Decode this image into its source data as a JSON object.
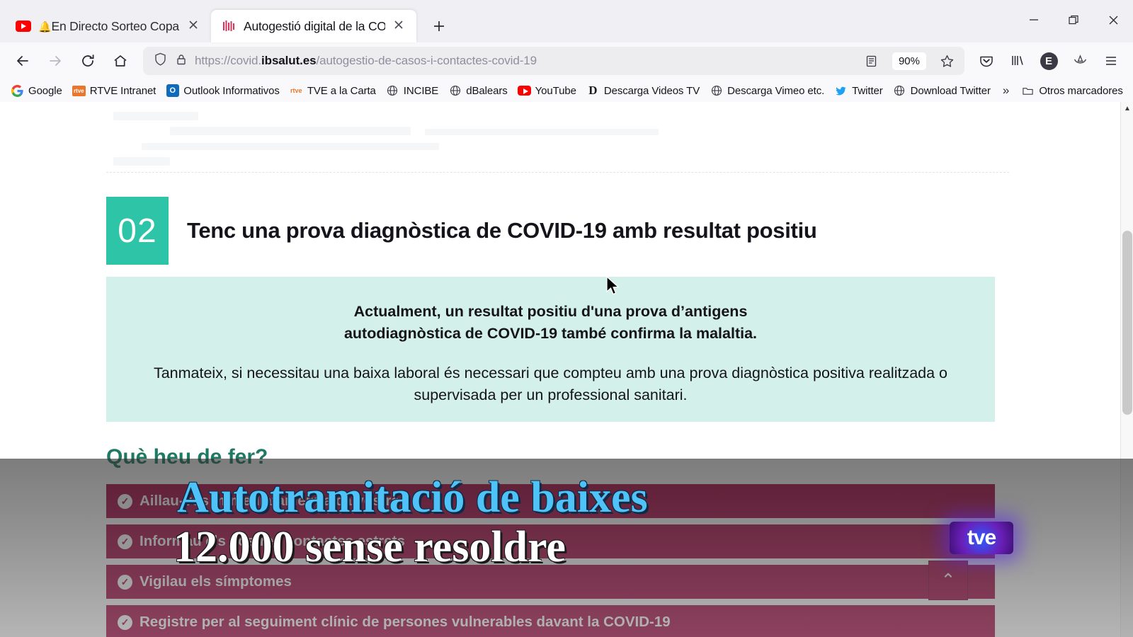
{
  "window": {
    "minimize_label": "Minimitza",
    "restore_label": "Restaura",
    "close_label": "Tanca"
  },
  "tabs": [
    {
      "title": "En Directo  Sorteo Copa de",
      "favicon": "youtube-icon",
      "active": false,
      "close_label": "×"
    },
    {
      "title": "Autogestió digital de la COVID-",
      "favicon": "ibsalut-icon",
      "active": true,
      "close_label": "×"
    }
  ],
  "newtab_label": "+",
  "toolbar": {
    "back_label": "←",
    "forward_label": "→",
    "reload_label": "↻",
    "home_label": "⌂",
    "shield_icon": "shield-icon",
    "lock_icon": "padlock-icon",
    "url_scheme": "https://covid.",
    "url_domain": "ibsalut.es",
    "url_path": "/autogestio-de-casos-i-contactes-covid-19",
    "url_full": "https://covid.ibsalut.es/autogestio-de-casos-i-contactes-covid-19",
    "reader_icon": "reader-view-icon",
    "zoom_level": "90%",
    "bookmark_star": "☆",
    "pocket_icon": "pocket-icon",
    "library_icon": "library-icon",
    "account_initial": "E",
    "container_icon": "container-tabs-icon",
    "menu_icon": "≡"
  },
  "bookmarks": {
    "items": [
      {
        "label": "Google",
        "icon": "google-icon"
      },
      {
        "label": "RTVE Intranet",
        "icon": "rtve-icon"
      },
      {
        "label": "Outlook Informativos",
        "icon": "outlook-icon"
      },
      {
        "label": "TVE a la Carta",
        "icon": "rtve-small-icon"
      },
      {
        "label": "INCIBE",
        "icon": "globe-icon"
      },
      {
        "label": "dBalears",
        "icon": "globe-icon"
      },
      {
        "label": "YouTube",
        "icon": "youtube-icon"
      },
      {
        "label": "Descarga Videos TV",
        "icon": "letter-d-icon"
      },
      {
        "label": "Descarga Vimeo etc.",
        "icon": "globe-icon"
      },
      {
        "label": "Twitter",
        "icon": "twitter-icon"
      },
      {
        "label": "Download Twitter",
        "icon": "globe-icon"
      }
    ],
    "overflow_label": "»",
    "other_folder": {
      "label": "Otros marcadores",
      "icon": "folder-icon"
    }
  },
  "page": {
    "section": {
      "number": "02",
      "title": "Tenc una prova diagnòstica de COVID-19 amb resultat positiu"
    },
    "infobox": {
      "bold_line_1": "Actualment, un resultat positiu d'una prova d’antigens",
      "bold_line_2": "autodiagnòstica de COVID-19 també confirma la malaltia.",
      "normal_line_1": "Tanmateix, si necessitau una baixa laboral és necessari que compteu amb una prova diagnòstica positiva realitzada o",
      "normal_line_2": "supervisada per un professional sanitari."
    },
    "subheading": "Què heu de fer?",
    "action_items": [
      {
        "label": "Aillau-vos immediatament a ca vostra",
        "icon": "check-circle-icon"
      },
      {
        "label": "Informau els vostres contactes estrets",
        "icon": "check-circle-icon"
      },
      {
        "label": "Vigilau els símptomes",
        "icon": "check-circle-icon"
      },
      {
        "label": "Registre per al seguiment clínic de persones vulnerables davant la COVID-19",
        "icon": "check-circle-icon"
      }
    ],
    "scroll_top_label": "⌃"
  },
  "broadcast": {
    "headline_line_1": "Autotramitació de baixes",
    "headline_line_2": "12.000 sense resoldre",
    "channel_logo": "tve"
  },
  "colors": {
    "accent_teal": "#2ec4a8",
    "infobox_bg": "#d3f0ea",
    "bar_red": "#a4003e",
    "subheading_green": "#1f7a63",
    "chyron_blue": "#4fc3f7"
  }
}
